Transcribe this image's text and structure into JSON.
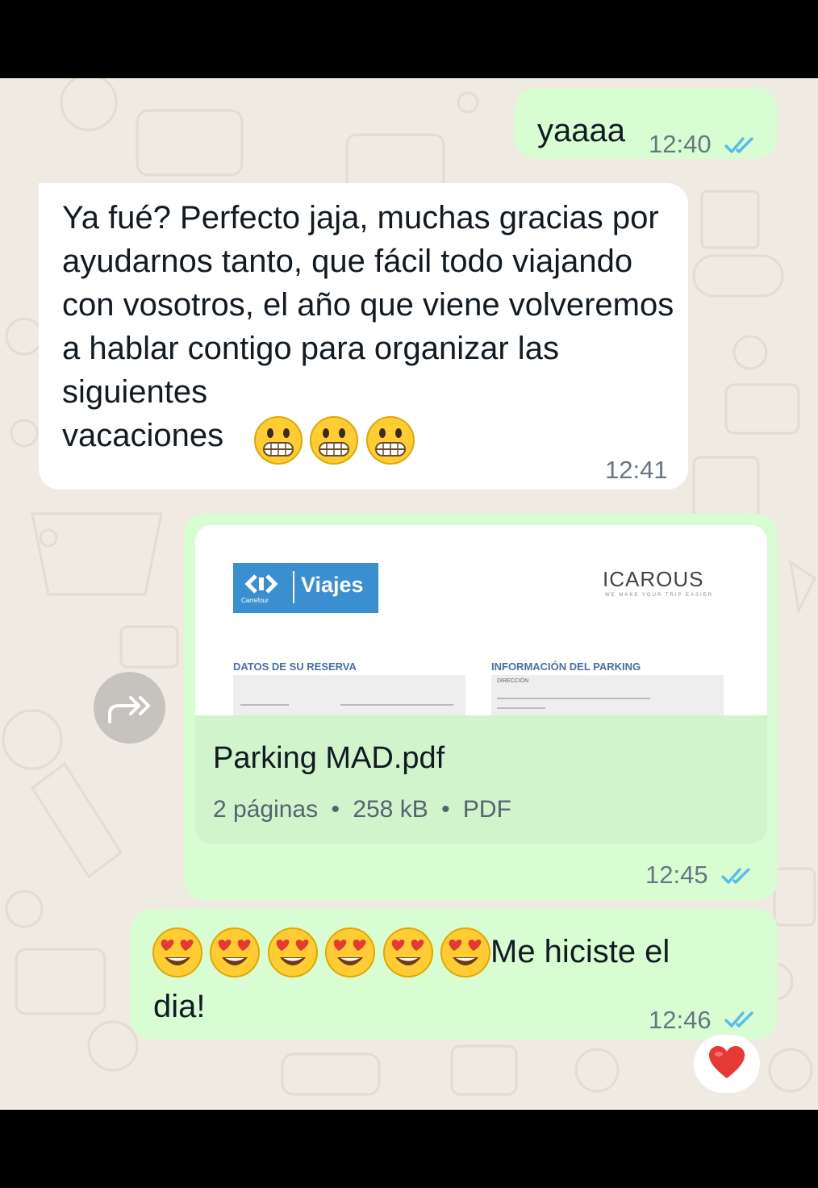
{
  "messages": [
    {
      "id": "m1",
      "direction": "outgoing",
      "text": "yaaaa",
      "time": "12:40",
      "status": "read"
    },
    {
      "id": "m2",
      "direction": "incoming",
      "text": "Ya fué? Perfecto jaja, muchas gracias por ayudarnos tanto, que fácil todo viajando con vosotros, el año que viene volveremos a hablar contigo para organizar las siguientes",
      "text_last_line": "vacaciones",
      "emojis": [
        "grimacing-face",
        "grimacing-face",
        "grimacing-face"
      ],
      "time": "12:41"
    },
    {
      "id": "m3",
      "direction": "outgoing",
      "type": "document",
      "file_name": "Parking MAD.pdf",
      "pages": "2 páginas",
      "size": "258 kB",
      "file_type": "PDF",
      "preview": {
        "logo_text": "Viajes",
        "logo_sub": "Carrefour",
        "partner_logo": "ICAROUS",
        "partner_tagline": "WE MAKE YOUR TRIP EASIER",
        "left_heading": "DATOS DE SU RESERVA",
        "right_heading": "INFORMACIÓN DEL PARKING",
        "right_label": "DIRECCIÓN"
      },
      "time": "12:45",
      "status": "read"
    },
    {
      "id": "m4",
      "direction": "outgoing",
      "emojis": [
        "heart-eyes-face",
        "heart-eyes-face",
        "heart-eyes-face",
        "heart-eyes-face",
        "heart-eyes-face",
        "heart-eyes-face"
      ],
      "text": "Me hiciste el",
      "text_line2": "dia!",
      "time": "12:46",
      "status": "read",
      "reaction": "red-heart"
    }
  ],
  "separators": {
    "dot": "•"
  },
  "colors": {
    "outgoing": "#d9fdd3",
    "incoming": "#ffffff",
    "wallpaper": "#efeae2",
    "read_ticks": "#53bdeb"
  }
}
